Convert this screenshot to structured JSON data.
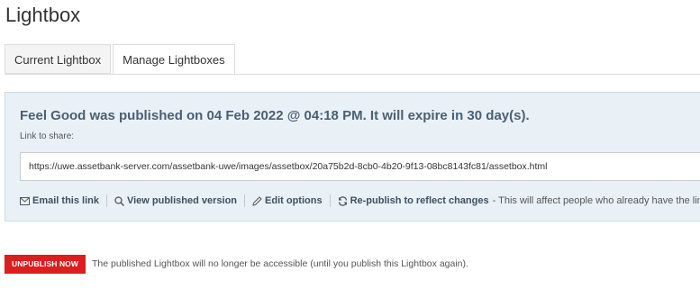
{
  "page": {
    "title": "Lightbox"
  },
  "tabs": [
    {
      "label": "Current Lightbox",
      "active": false
    },
    {
      "label": "Manage Lightboxes",
      "active": true
    }
  ],
  "publish_panel": {
    "heading": "Feel Good was published on 04 Feb 2022 @ 04:18 PM. It will expire in 30 day(s).",
    "share_label": "Link to share:",
    "share_link": "https://uwe.assetbank-server.com/assetbank-uwe/images/assetbox/20a75b2d-8cb0-4b20-9f13-08bc8143fc81/assetbox.html",
    "actions": {
      "email": {
        "label": "Email this link",
        "icon": "envelope-icon"
      },
      "view": {
        "label": "View published version",
        "icon": "search-icon"
      },
      "edit": {
        "label": "Edit options",
        "icon": "pencil-icon"
      },
      "republish": {
        "label": "Re-publish to reflect changes",
        "icon": "refresh-icon"
      }
    },
    "republish_note": "- This will affect people who already have the link"
  },
  "unpublish": {
    "button_label": "UNPUBLISH NOW",
    "note": "The published Lightbox will no longer be accessible (until you publish this Lightbox again)."
  },
  "colors": {
    "panel_background": "#e9f1f7",
    "heading_text": "#4a5f72",
    "danger": "#d9201f"
  }
}
